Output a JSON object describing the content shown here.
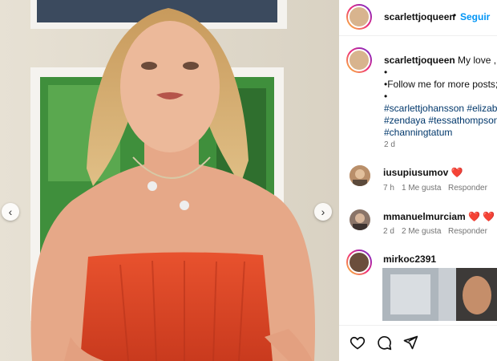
{
  "post": {
    "username": "scarlettjoqueen",
    "follow_label": "Seguir",
    "separator": "•"
  },
  "caption": {
    "username": "scarlettjoqueen",
    "text": "My love , M",
    "line1": "•",
    "line2_prefix": "•Follow me for more posts;",
    "line2_link": "@",
    "line3": "•",
    "tags_line1": [
      "#scarlettjohansson",
      "#elizabe"
    ],
    "tags_line2": [
      "#zendaya",
      "#tessathompson",
      "#"
    ],
    "tags_line3": [
      "#channingtatum"
    ],
    "time": "2 d"
  },
  "comments": [
    {
      "username": "iusupiusumov",
      "text": "❤️",
      "time": "7 h",
      "likes": "1 Me gusta",
      "reply": "Responder"
    },
    {
      "username": "mmanuelmurciam",
      "text": "❤️ ❤️ ❤️",
      "time": "2 d",
      "likes": "2 Me gusta",
      "reply": "Responder"
    },
    {
      "username": "mirkoc2391"
    }
  ],
  "icons": {
    "like": "heart-outline-icon",
    "comment": "comment-bubble-icon",
    "share": "paper-plane-icon",
    "prev": "chevron-left-icon",
    "next": "chevron-right-icon"
  },
  "colors": {
    "link_blue": "#0095f6",
    "tag_blue": "#00376b",
    "heart_red": "#e0245e",
    "secondary_text": "#737373"
  },
  "carousel": {
    "prev_glyph": "‹",
    "next_glyph": "›"
  }
}
